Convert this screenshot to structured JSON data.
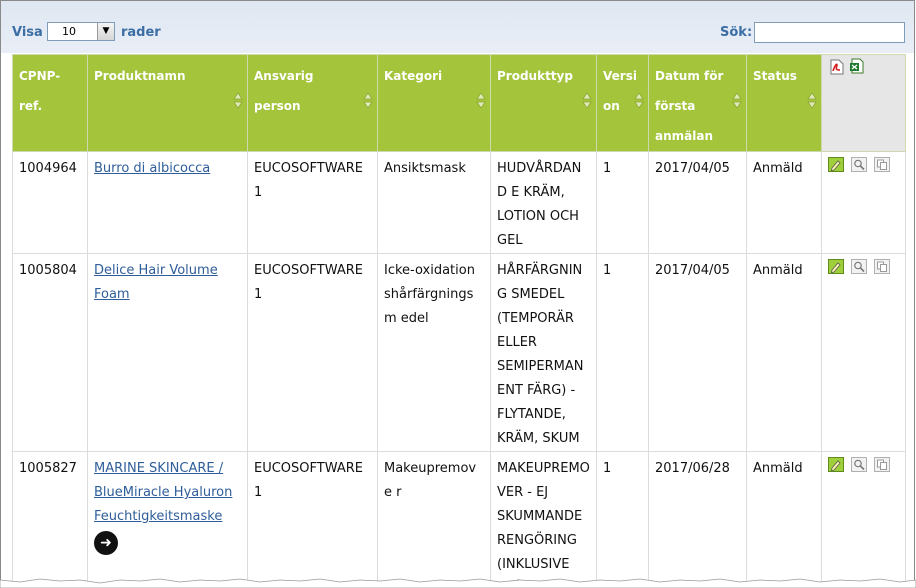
{
  "length_menu": {
    "prefix": "Visa",
    "value": "10",
    "suffix": "rader"
  },
  "search": {
    "label": "Sök:",
    "value": ""
  },
  "columns": [
    {
      "label": "CPNP-ref."
    },
    {
      "label": "Produktnamn"
    },
    {
      "label": "Ansvarig person"
    },
    {
      "label": "Kategori"
    },
    {
      "label": "Produkttyp"
    },
    {
      "label": "Versi on"
    },
    {
      "label": "Datum för första anmälan"
    },
    {
      "label": "Status"
    }
  ],
  "export_icons": [
    "pdf-export-icon",
    "excel-export-icon"
  ],
  "rows": [
    {
      "cpnp": "1004964",
      "product": "Burro di albicocca",
      "person": "EUCOSOFTWARE 1",
      "category": "Ansiktsmask",
      "type": "HUDVÅRDAND E KRÄM, LOTION OCH GEL",
      "version": "1",
      "date": "2017/04/05",
      "status": "Anmäld"
    },
    {
      "cpnp": "1005804",
      "product": "Delice Hair Volume Foam",
      "person": "EUCOSOFTWARE 1",
      "category": "Icke-oxidation shårfärgningsm edel",
      "type": "HÅRFÄRGNING SMEDEL (TEMPORÄR ELLER SEMIPERMAN ENT FÄRG) - FLYTANDE, KRÄM, SKUM",
      "version": "1",
      "date": "2017/04/05",
      "status": "Anmäld"
    },
    {
      "cpnp": "1005827",
      "product": "MARINE SKINCARE / BlueMiracle Hyaluron Feuchtigkeitsmaske",
      "person": "EUCOSOFTWARE 1",
      "category": "Makeupremove r",
      "type": "MAKEUPREMO VER - EJ SKUMMANDE RENGÖRING (INKLUSIVE TVÅFASPROD",
      "version": "1",
      "date": "2017/06/28",
      "status": "Anmäld"
    }
  ],
  "row_actions": [
    "edit-icon",
    "view-icon",
    "copy-icon"
  ],
  "colors": {
    "header_green": "#a4c43c",
    "link_blue": "#2f5d9a",
    "label_blue": "#3b6ea5"
  }
}
